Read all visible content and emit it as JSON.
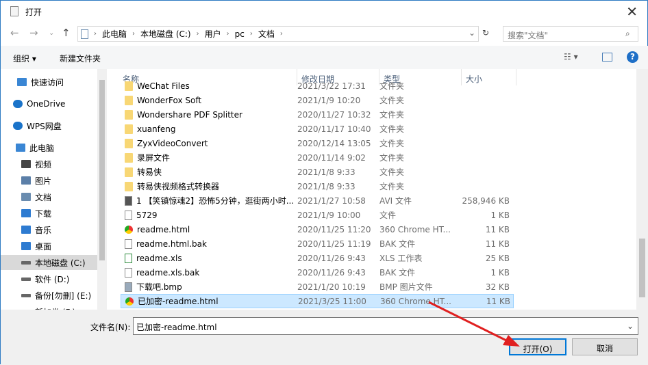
{
  "window": {
    "title": "打开"
  },
  "address": {
    "crumbs": [
      "此电脑",
      "本地磁盘 (C:)",
      "用户",
      "pc",
      "文档"
    ]
  },
  "search": {
    "placeholder": "搜索\"文档\""
  },
  "toolbar": {
    "organize": "组织 ▾",
    "new_folder": "新建文件夹"
  },
  "sidebar": {
    "items": [
      {
        "label": "快速访问",
        "icon": "star-icon"
      },
      {
        "label": "OneDrive",
        "icon": "cloud-icon"
      },
      {
        "label": "WPS网盘",
        "icon": "cloud-icon"
      },
      {
        "label": "此电脑",
        "icon": "computer-icon"
      },
      {
        "label": "视频",
        "icon": "video-icon"
      },
      {
        "label": "图片",
        "icon": "picture-icon"
      },
      {
        "label": "文档",
        "icon": "document-icon"
      },
      {
        "label": "下载",
        "icon": "download-icon"
      },
      {
        "label": "音乐",
        "icon": "music-icon"
      },
      {
        "label": "桌面",
        "icon": "desktop-icon"
      },
      {
        "label": "本地磁盘 (C:)",
        "icon": "drive-icon"
      },
      {
        "label": "软件 (D:)",
        "icon": "drive-icon"
      },
      {
        "label": "备份[勿删] (E:)",
        "icon": "drive-icon"
      },
      {
        "label": "新加卷 (F:)",
        "icon": "drive-icon"
      }
    ]
  },
  "columns": {
    "name": "名称",
    "date": "修改日期",
    "type": "类型",
    "size": "大小"
  },
  "files": [
    {
      "name": "WeChat Files",
      "date": "2021/3/22 17:31",
      "type": "文件夹",
      "size": "",
      "kind": "folder"
    },
    {
      "name": "WonderFox Soft",
      "date": "2021/1/9 10:20",
      "type": "文件夹",
      "size": "",
      "kind": "folder"
    },
    {
      "name": "Wondershare PDF Splitter",
      "date": "2020/11/27 10:32",
      "type": "文件夹",
      "size": "",
      "kind": "folder"
    },
    {
      "name": "xuanfeng",
      "date": "2020/11/17 10:40",
      "type": "文件夹",
      "size": "",
      "kind": "folder"
    },
    {
      "name": "ZyxVideoConvert",
      "date": "2020/12/14 13:05",
      "type": "文件夹",
      "size": "",
      "kind": "folder"
    },
    {
      "name": "录屏文件",
      "date": "2020/11/14 9:02",
      "type": "文件夹",
      "size": "",
      "kind": "folder"
    },
    {
      "name": "转易侠",
      "date": "2021/1/8 9:33",
      "type": "文件夹",
      "size": "",
      "kind": "folder"
    },
    {
      "name": "转易侠视频格式转换器",
      "date": "2021/1/8 9:33",
      "type": "文件夹",
      "size": "",
      "kind": "folder"
    },
    {
      "name": "1 【笑镇惊魂2】恐怖5分钟，逛街两小时...",
      "date": "2021/1/27 10:58",
      "type": "AVI 文件",
      "size": "258,946 KB",
      "kind": "video"
    },
    {
      "name": "5729",
      "date": "2021/1/9 10:00",
      "type": "文件",
      "size": "1 KB",
      "kind": "file"
    },
    {
      "name": "readme.html",
      "date": "2020/11/25 11:20",
      "type": "360 Chrome HT...",
      "size": "11 KB",
      "kind": "chrome"
    },
    {
      "name": "readme.html.bak",
      "date": "2020/11/25 11:19",
      "type": "BAK 文件",
      "size": "11 KB",
      "kind": "file"
    },
    {
      "name": "readme.xls",
      "date": "2020/11/26 9:43",
      "type": "XLS 工作表",
      "size": "25 KB",
      "kind": "xls"
    },
    {
      "name": "readme.xls.bak",
      "date": "2020/11/26 9:43",
      "type": "BAK 文件",
      "size": "1 KB",
      "kind": "file"
    },
    {
      "name": "下载吧.bmp",
      "date": "2021/1/20 10:19",
      "type": "BMP 图片文件",
      "size": "32 KB",
      "kind": "bmp"
    },
    {
      "name": "已加密-readme.html",
      "date": "2021/3/25 11:00",
      "type": "360 Chrome HT...",
      "size": "11 KB",
      "kind": "chrome",
      "selected": true
    }
  ],
  "bottom": {
    "filename_label": "文件名(N):",
    "filename_value": "已加密-readme.html",
    "open": "打开(O)",
    "cancel": "取消"
  }
}
